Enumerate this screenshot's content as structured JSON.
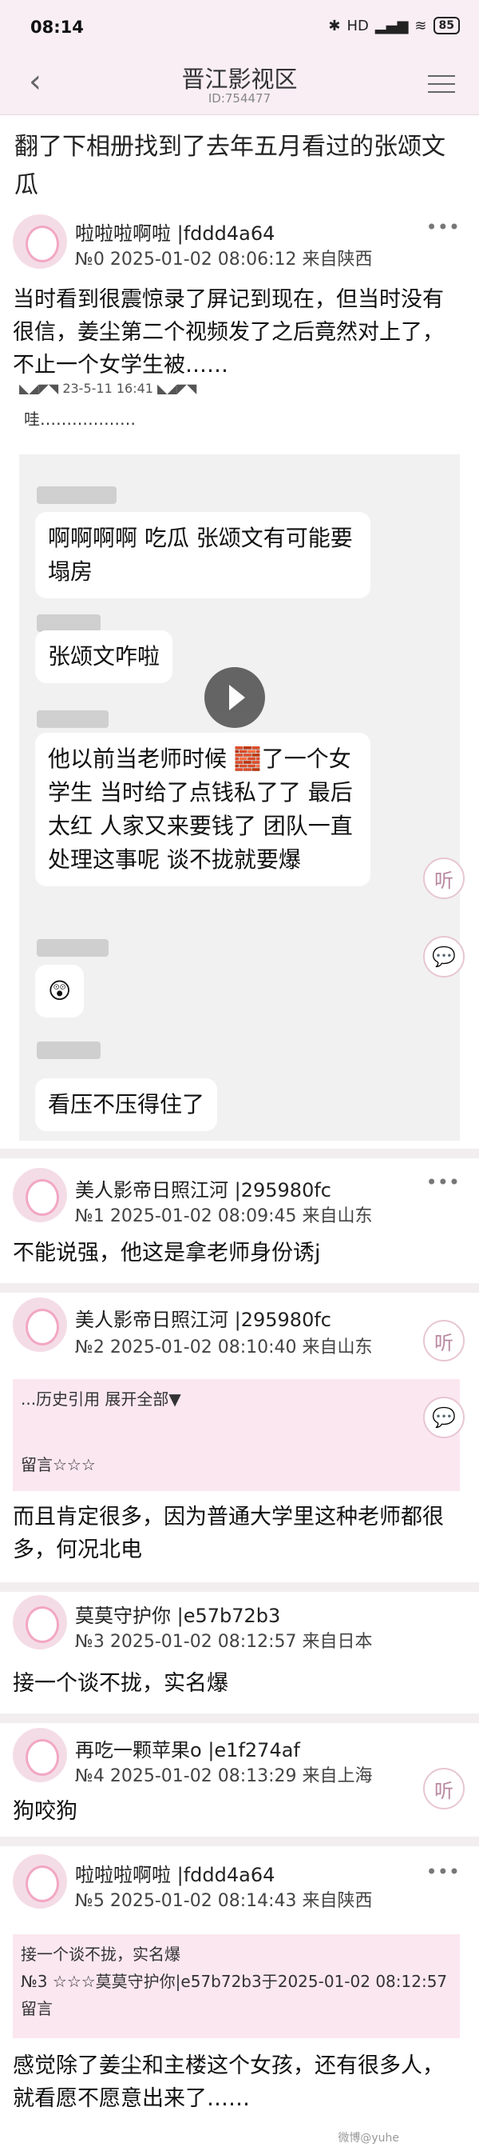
{
  "status": {
    "time": "08:14",
    "battery": "85"
  },
  "nav": {
    "title": "晋江影视区",
    "id": "ID:754477"
  },
  "thread_title": "翻了下相册找到了去年五月看过的张颂文瓜",
  "posts": [
    {
      "user": "啦啦啦啊啦",
      "uid": "|fddd4a64",
      "meta": "№0 2025-01-02 08:06:12 来自陕西",
      "text": "当时看到很震惊录了屏记到现在，但当时没有很信，姜尘第二个视频发了之后竟然对上了，不止一个女学生被……"
    },
    {
      "user": "美人影帝日照江河",
      "uid": "|295980fc",
      "meta": "№1 2025-01-02 08:09:45 来自山东",
      "text": "不能说强，他这是拿老师身份诱j"
    },
    {
      "user": "美人影帝日照江河",
      "uid": "|295980fc",
      "meta": "№2 2025-01-02 08:10:40 来自山东",
      "quote": "...历史引用 展开全部▼",
      "quote2": "留言☆☆☆",
      "text": "而且肯定很多，因为普通大学里这种老师都很多，何况北电"
    },
    {
      "user": "莫莫守护你",
      "uid": "|e57b72b3",
      "meta": "№3 2025-01-02 08:12:57 来自日本",
      "text": "接一个谈不拢，实名爆"
    },
    {
      "user": "再吃一颗苹果o",
      "uid": "|e1f274af",
      "meta": "№4 2025-01-02 08:13:29 来自上海",
      "text": "狗咬狗"
    },
    {
      "user": "啦啦啦啊啦",
      "uid": "|fddd4a64",
      "meta": "№5 2025-01-02 08:14:43 来自陕西",
      "quote": "接一个谈不拢，实名爆",
      "quote2": "№3 ☆☆☆莫莫守护你|e57b72b3于2025-01-02 08:12:57留言",
      "text": "感觉除了姜尘和主楼这个女孩，还有很多人，就看愿不愿意出来了……"
    }
  ],
  "screenshot": {
    "date": "23-5-11 16:41",
    "wa": "哇………………",
    "b1": "啊啊啊啊 吃瓜 张颂文有可能要塌房",
    "b2": "张颂文咋啦",
    "b3": "他以前当老师时候 🧱了一个女学生 当时给了点钱私了了 最后太红 人家又来要钱了 团队一直处理这事呢 谈不拢就要爆",
    "b4": "😲",
    "b5": "看压不压得住了"
  },
  "side": {
    "listen": "听",
    "comment": "💬"
  },
  "watermark": "微博@yuhe"
}
